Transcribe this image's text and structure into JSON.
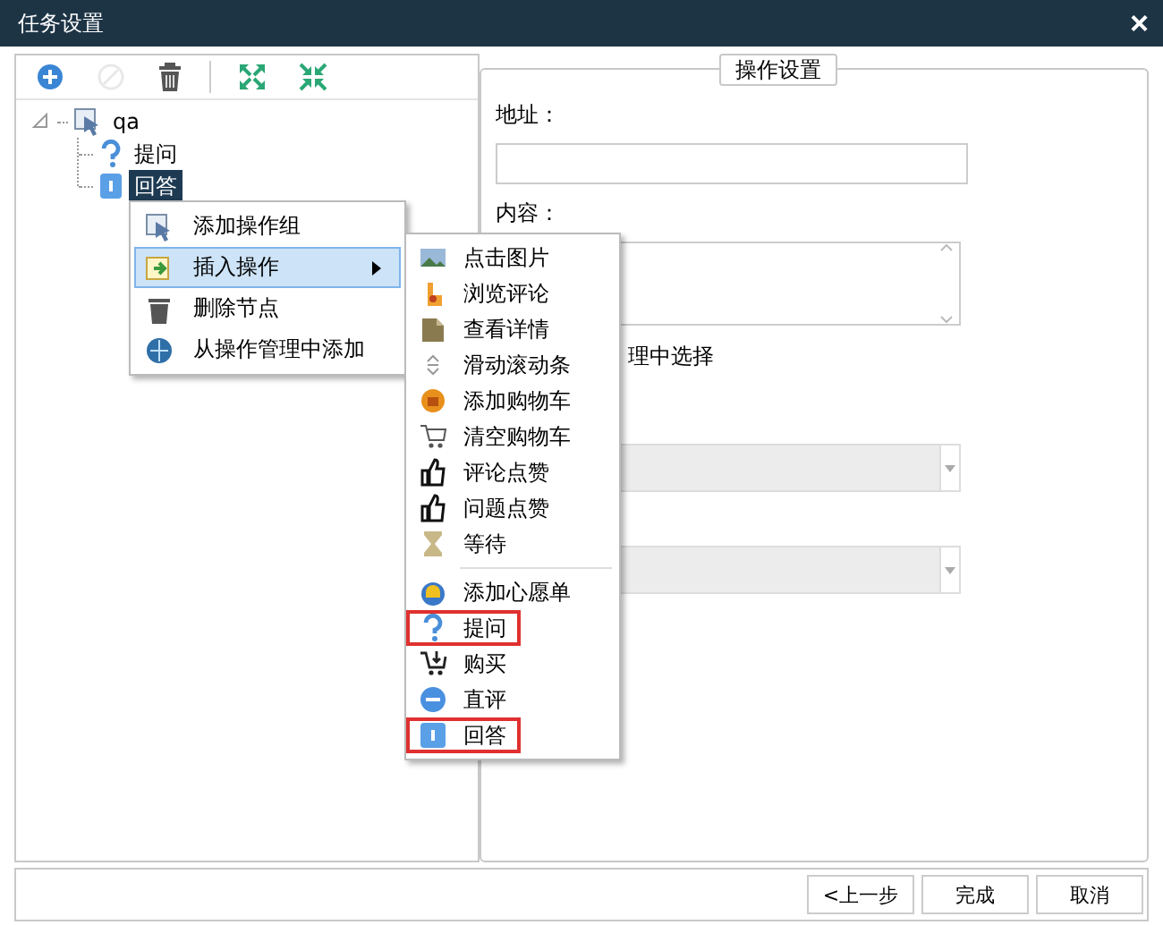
{
  "window": {
    "title": "任务设置",
    "close": "×"
  },
  "toolbar": [
    {
      "kind": "add",
      "disabled": false
    },
    {
      "kind": "block",
      "disabled": true
    },
    {
      "kind": "delete",
      "disabled": false
    },
    {
      "kind": "expand",
      "disabled": false
    },
    {
      "kind": "collapse",
      "disabled": false
    }
  ],
  "tree": [
    {
      "label": "qa",
      "expanded": true,
      "selected": false,
      "children": [
        {
          "label": "提问",
          "selected": false
        },
        {
          "label": "回答",
          "selected": true
        }
      ]
    }
  ],
  "settings": {
    "title": "操作设置",
    "address_label": "地址：",
    "content_label": "内容：",
    "option_text": "理中选择"
  },
  "context_menu": [
    {
      "label": "添加操作组",
      "selected": false,
      "submenu": false
    },
    {
      "label": "插入操作",
      "selected": true,
      "submenu": true
    },
    {
      "label": "删除节点",
      "selected": false,
      "submenu": false
    },
    {
      "label": "从操作管理中添加",
      "selected": false,
      "submenu": false
    }
  ],
  "submenu": [
    {
      "label": "点击图片",
      "outlined": false
    },
    {
      "label": "浏览评论",
      "outlined": false
    },
    {
      "label": "查看详情",
      "outlined": false
    },
    {
      "label": "滑动滚动条",
      "outlined": false
    },
    {
      "label": "添加购物车",
      "outlined": false
    },
    {
      "label": "清空购物车",
      "outlined": false
    },
    {
      "label": "评论点赞",
      "outlined": false
    },
    {
      "label": "问题点赞",
      "outlined": false
    },
    {
      "label": "等待",
      "outlined": false,
      "separator_after": true
    },
    {
      "label": "添加心愿单",
      "outlined": false
    },
    {
      "label": "提问",
      "outlined": true
    },
    {
      "label": "购买",
      "outlined": false
    },
    {
      "label": "直评",
      "outlined": false
    },
    {
      "label": "回答",
      "outlined": true
    }
  ],
  "buttons": [
    "<上一步",
    "完成",
    "取消"
  ]
}
